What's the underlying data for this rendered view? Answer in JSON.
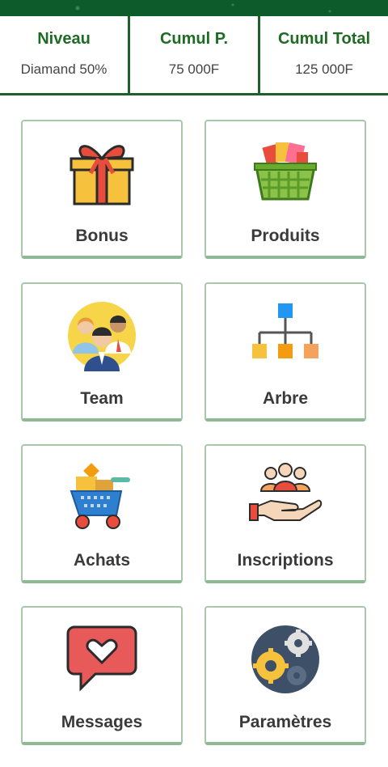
{
  "stats": [
    {
      "title": "Niveau",
      "value": "Diamand 50%"
    },
    {
      "title": "Cumul P.",
      "value": "75 000F"
    },
    {
      "title": "Cumul Total",
      "value": "125 000F"
    }
  ],
  "menu": [
    {
      "label": "Bonus",
      "icon": "gift-icon"
    },
    {
      "label": "Produits",
      "icon": "basket-icon"
    },
    {
      "label": "Team",
      "icon": "team-icon"
    },
    {
      "label": "Arbre",
      "icon": "tree-icon"
    },
    {
      "label": "Achats",
      "icon": "cart-icon"
    },
    {
      "label": "Inscriptions",
      "icon": "registration-icon"
    },
    {
      "label": "Messages",
      "icon": "message-icon"
    },
    {
      "label": "Paramètres",
      "icon": "settings-icon"
    }
  ],
  "colors": {
    "primary_green": "#1e6b23",
    "card_border": "#a8c8ac"
  }
}
